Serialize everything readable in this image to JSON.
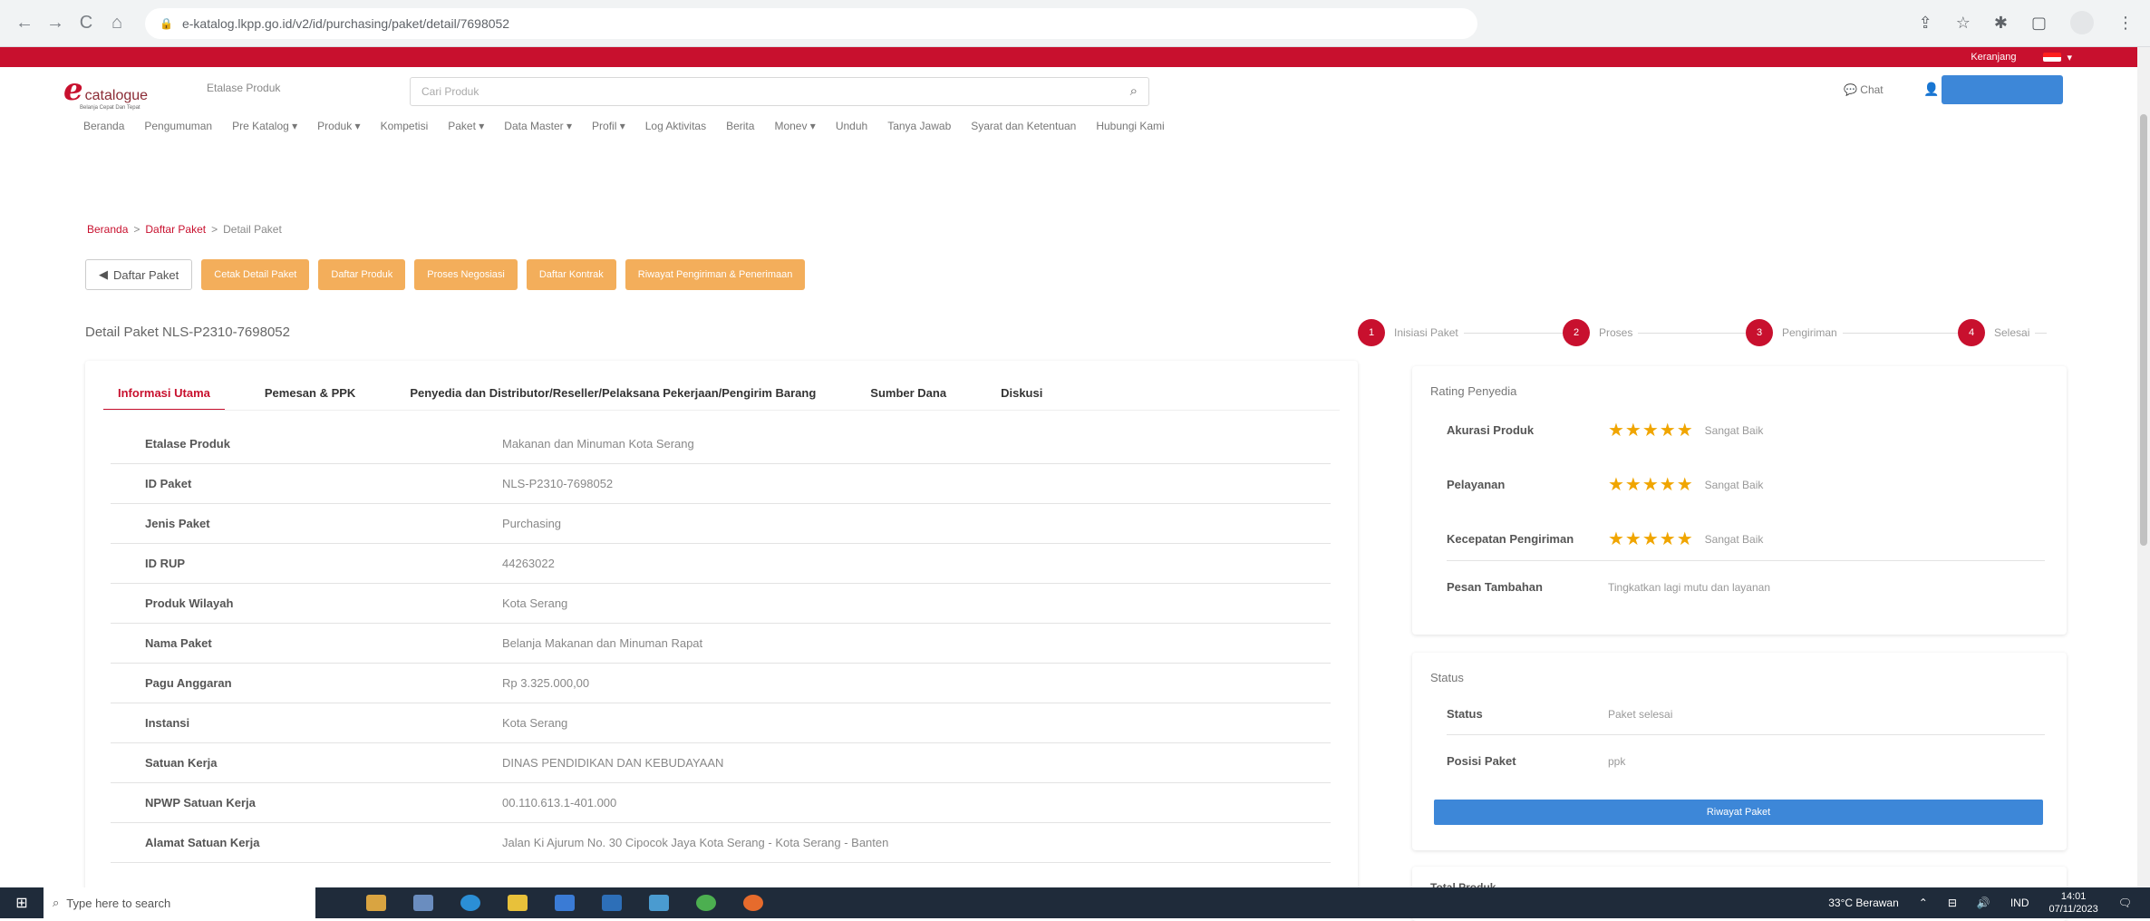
{
  "browser": {
    "url": "e-katalog.lkpp.go.id/v2/id/purchasing/paket/detail/7698052",
    "nav_back": "←",
    "nav_forward": "→",
    "nav_reload": "C",
    "nav_home": "⌂"
  },
  "topbar": {
    "lang_label": "Keranjang"
  },
  "header": {
    "logo_letter": "e",
    "logo_text": "catalogue",
    "logo_sub": "Belanja Cepat Dan Tepat",
    "etalase_select": "Etalase Produk",
    "search_placeholder": "Cari Produk",
    "chat_label": "Chat"
  },
  "nav": [
    "Beranda",
    "Pengumuman",
    "Pre Katalog ▾",
    "Produk ▾",
    "Kompetisi",
    "Paket ▾",
    "Data Master ▾",
    "Profil ▾",
    "Log Aktivitas",
    "Berita",
    "Monev ▾",
    "Unduh",
    "Tanya Jawab",
    "Syarat dan Ketentuan",
    "Hubungi Kami"
  ],
  "breadcrumb": {
    "home": "Beranda",
    "sep1": ">",
    "list": "Daftar Paket",
    "sep2": ">",
    "current": "Detail Paket"
  },
  "actions": {
    "back": "Daftar Paket",
    "buttons": [
      "Cetak Detail Paket",
      "Daftar Produk",
      "Proses Negosiasi",
      "Daftar Kontrak",
      "Riwayat Pengiriman & Penerimaan"
    ]
  },
  "detail_title": "Detail Paket NLS-P2310-7698052",
  "steps": [
    {
      "num": "1",
      "label": "Inisiasi Paket"
    },
    {
      "num": "2",
      "label": "Proses"
    },
    {
      "num": "3",
      "label": "Pengiriman"
    },
    {
      "num": "4",
      "label": "Selesai"
    }
  ],
  "tabs": [
    "Informasi Utama",
    "Pemesan & PPK",
    "Penyedia dan Distributor/Reseller/Pelaksana Pekerjaan/Pengirim Barang",
    "Sumber Dana",
    "Diskusi"
  ],
  "info_rows": [
    {
      "label": "Etalase Produk",
      "value": "Makanan dan Minuman Kota Serang"
    },
    {
      "label": "ID Paket",
      "value": "NLS-P2310-7698052"
    },
    {
      "label": "Jenis Paket",
      "value": "Purchasing"
    },
    {
      "label": "ID RUP",
      "value": "44263022"
    },
    {
      "label": "Produk Wilayah",
      "value": "Kota Serang"
    },
    {
      "label": "Nama Paket",
      "value": "Belanja Makanan dan Minuman Rapat"
    },
    {
      "label": "Pagu Anggaran",
      "value": "Rp 3.325.000,00"
    },
    {
      "label": "Instansi",
      "value": "Kota Serang"
    },
    {
      "label": "Satuan Kerja",
      "value": "DINAS PENDIDIKAN DAN KEBUDAYAAN"
    },
    {
      "label": "NPWP Satuan Kerja",
      "value": "00.110.613.1-401.000"
    },
    {
      "label": "Alamat Satuan Kerja",
      "value": "Jalan Ki Ajurum No. 30 Cipocok Jaya Kota Serang - Kota Serang - Banten"
    }
  ],
  "rating": {
    "title": "Rating Penyedia",
    "rows": [
      {
        "label": "Akurasi Produk",
        "stars": "★★★★★",
        "value": "Sangat Baik"
      },
      {
        "label": "Pelayanan",
        "stars": "★★★★★",
        "value": "Sangat Baik"
      },
      {
        "label": "Kecepatan Pengiriman",
        "stars": "★★★★★",
        "value": "Sangat Baik"
      }
    ],
    "extra_label": "Pesan Tambahan",
    "extra_value": "Tingkatkan lagi mutu dan layanan"
  },
  "status": {
    "title": "Status",
    "rows": [
      {
        "label": "Status",
        "value": "Paket selesai"
      },
      {
        "label": "Posisi Paket",
        "value": "ppk"
      }
    ],
    "history_button": "Riwayat Paket"
  },
  "total": {
    "title": "Total Produk"
  },
  "taskbar": {
    "search_placeholder": "Type here to search",
    "weather": "33°C Berawan",
    "lang": "IND",
    "time": "14:01",
    "date": "07/11/2023"
  },
  "colors": {
    "brand_red": "#c8102e",
    "orange_button": "#f3ae5b",
    "blue_button": "#3d87d8",
    "star": "#f0a500"
  }
}
